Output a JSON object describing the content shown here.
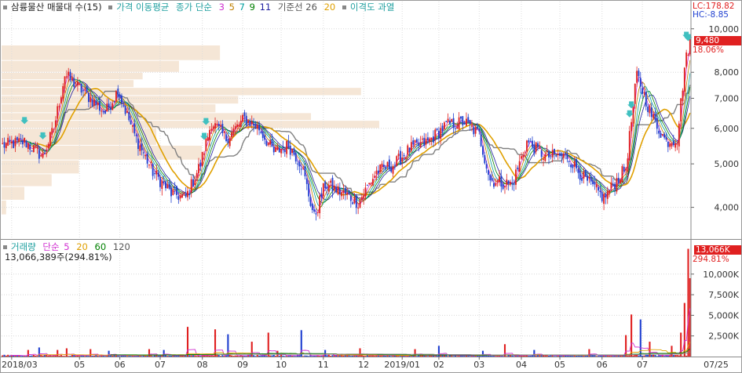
{
  "header": {
    "title": "삼륭물산 매물대 수(15)",
    "ma_label": "가격 이동평균",
    "ma_type": "종가 단순",
    "ma_periods": [
      "3",
      "5",
      "7",
      "9",
      "11"
    ],
    "base_label": "기준선 26",
    "base_extra": "20",
    "disparity": "이격도 과열",
    "lc": "LC:178.82",
    "hc": "HC:-8.85"
  },
  "price_badge": {
    "value": "9,480",
    "pct": "18.06%"
  },
  "volume_header": {
    "label": "거래량",
    "type": "단순",
    "periods": [
      "5",
      "20",
      "60",
      "120"
    ],
    "value_text": "13,066,389주(294.81%)"
  },
  "volume_badge": {
    "value": "13,066K",
    "pct": "294.81%"
  },
  "colors": {
    "up": "#e02020",
    "down": "#2040d0",
    "ma3": "#d030d0",
    "ma5": "#c08000",
    "ma7": "#00a0a0",
    "ma9": "#008000",
    "ma11": "#2020a0",
    "base": "#808080",
    "ma20": "#e0a000",
    "profile": "#f5e6d6",
    "arrow": "#40c0c0"
  },
  "chart_data": [
    {
      "type": "candlestick",
      "title": "삼륭물산 매물대 수(15)",
      "y_scale": "log",
      "ylim": [
        3400,
        11500
      ],
      "y_ticks": [
        4000,
        5000,
        6000,
        7000,
        8000,
        10000
      ],
      "y_tick_labels": [
        "4,000",
        "5,000",
        "6,000",
        "7,000",
        "8,000",
        "10,000"
      ],
      "x_ticks": [
        "2018/03",
        "05",
        "06",
        "07",
        "08",
        "09",
        "10",
        "11",
        "12",
        "2019/01",
        "02",
        "03",
        "04",
        "05",
        "06",
        "07",
        "07/25"
      ],
      "x_tick_index": [
        5,
        42,
        64,
        86,
        109,
        131,
        152,
        175,
        197,
        218,
        238,
        260,
        283,
        304,
        327,
        349,
        375
      ],
      "n_bars": 376,
      "close_anchors": [
        [
          0,
          5500
        ],
        [
          12,
          5600
        ],
        [
          22,
          5200
        ],
        [
          28,
          6000
        ],
        [
          34,
          7900
        ],
        [
          40,
          7500
        ],
        [
          48,
          7000
        ],
        [
          56,
          6500
        ],
        [
          63,
          7300
        ],
        [
          72,
          5800
        ],
        [
          82,
          4800
        ],
        [
          92,
          4300
        ],
        [
          100,
          4200
        ],
        [
          108,
          5000
        ],
        [
          114,
          6200
        ],
        [
          122,
          5700
        ],
        [
          132,
          6300
        ],
        [
          140,
          6000
        ],
        [
          148,
          5300
        ],
        [
          156,
          5500
        ],
        [
          163,
          5000
        ],
        [
          170,
          3800
        ],
        [
          176,
          4500
        ],
        [
          186,
          4300
        ],
        [
          194,
          4100
        ],
        [
          204,
          4800
        ],
        [
          214,
          5000
        ],
        [
          222,
          5400
        ],
        [
          232,
          5600
        ],
        [
          242,
          6100
        ],
        [
          252,
          6200
        ],
        [
          260,
          5800
        ],
        [
          266,
          4600
        ],
        [
          278,
          4500
        ],
        [
          286,
          5600
        ],
        [
          296,
          5200
        ],
        [
          308,
          5200
        ],
        [
          318,
          4600
        ],
        [
          328,
          4200
        ],
        [
          340,
          4900
        ],
        [
          346,
          7900
        ],
        [
          354,
          6400
        ],
        [
          362,
          5600
        ],
        [
          368,
          5700
        ],
        [
          372,
          8200
        ],
        [
          375,
          9480
        ]
      ],
      "volume_profile": [
        {
          "price_low": 8500,
          "price_high": 9200,
          "volume": 0.48
        },
        {
          "price_low": 8000,
          "price_high": 8500,
          "volume": 0.39
        },
        {
          "price_low": 7700,
          "price_high": 8000,
          "volume": 0.31
        },
        {
          "price_low": 7400,
          "price_high": 7700,
          "volume": 0.29
        },
        {
          "price_low": 7100,
          "price_high": 7400,
          "volume": 0.79
        },
        {
          "price_low": 6800,
          "price_high": 7100,
          "volume": 0.52
        },
        {
          "price_low": 6500,
          "price_high": 6800,
          "volume": 0.47
        },
        {
          "price_low": 6250,
          "price_high": 6500,
          "volume": 0.68
        },
        {
          "price_low": 6000,
          "price_high": 6250,
          "volume": 0.83
        },
        {
          "price_low": 5500,
          "price_high": 6000,
          "volume": 0.34
        },
        {
          "price_low": 5100,
          "price_high": 5500,
          "volume": 0.44
        },
        {
          "price_low": 4750,
          "price_high": 5100,
          "volume": 0.17
        },
        {
          "price_low": 4450,
          "price_high": 4750,
          "volume": 0.11
        },
        {
          "price_low": 4150,
          "price_high": 4450,
          "volume": 0.05
        },
        {
          "price_low": 3850,
          "price_high": 4150,
          "volume": 0.01
        }
      ]
    },
    {
      "type": "bar",
      "title": "거래량",
      "ylim": [
        0,
        13400000
      ],
      "y_ticks": [
        2500000,
        5000000,
        7500000,
        10000000
      ],
      "y_tick_labels": [
        "2,500K",
        "5,000K",
        "7,500K",
        "10,000K"
      ],
      "last_value": 13066389,
      "spikes": [
        [
          14,
          800000
        ],
        [
          20,
          1100000
        ],
        [
          30,
          800000
        ],
        [
          35,
          1000000
        ],
        [
          48,
          900000
        ],
        [
          58,
          700000
        ],
        [
          80,
          900000
        ],
        [
          88,
          800000
        ],
        [
          101,
          3600000
        ],
        [
          116,
          3300000
        ],
        [
          123,
          2700000
        ],
        [
          136,
          1800000
        ],
        [
          145,
          2900000
        ],
        [
          150,
          700000
        ],
        [
          163,
          3200000
        ],
        [
          176,
          800000
        ],
        [
          195,
          1000000
        ],
        [
          225,
          900000
        ],
        [
          238,
          1300000
        ],
        [
          262,
          700000
        ],
        [
          274,
          1500000
        ],
        [
          290,
          800000
        ],
        [
          320,
          900000
        ],
        [
          340,
          2600000
        ],
        [
          343,
          5100000
        ],
        [
          348,
          4500000
        ],
        [
          353,
          1800000
        ],
        [
          365,
          1300000
        ],
        [
          370,
          2900000
        ],
        [
          372,
          6500000
        ],
        [
          374,
          13066389
        ],
        [
          375,
          9500000
        ]
      ]
    }
  ]
}
